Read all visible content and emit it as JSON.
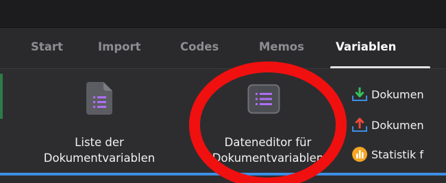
{
  "tabs": [
    {
      "label": "Start",
      "active": false
    },
    {
      "label": "Import",
      "active": false
    },
    {
      "label": "Codes",
      "active": false
    },
    {
      "label": "Memos",
      "active": false
    },
    {
      "label": "Variablen",
      "active": true
    }
  ],
  "ribbon": {
    "list_button": {
      "line1": "Liste der",
      "line2": "Dokumentvariablen",
      "icon": "document-list-icon"
    },
    "editor_button": {
      "line1": "Dateneditor für",
      "line2": "Dokumentvariablen",
      "icon": "table-editor-icon"
    },
    "small_buttons": [
      {
        "label": "Dokumen",
        "icon": "import-arrow-icon"
      },
      {
        "label": "Dokumen",
        "icon": "export-arrow-icon"
      },
      {
        "label": "Statistik f",
        "icon": "statistics-icon"
      }
    ]
  },
  "colors": {
    "tab_active": "#ffffff",
    "tab_inactive": "#8e8e92",
    "icon_purple": "#b06ef5",
    "annotation_red": "#f01010",
    "import_green": "#35c25a",
    "export_red": "#f0483a",
    "stats_orange": "#f5a623",
    "accent_blue": "#3c8fe6"
  }
}
